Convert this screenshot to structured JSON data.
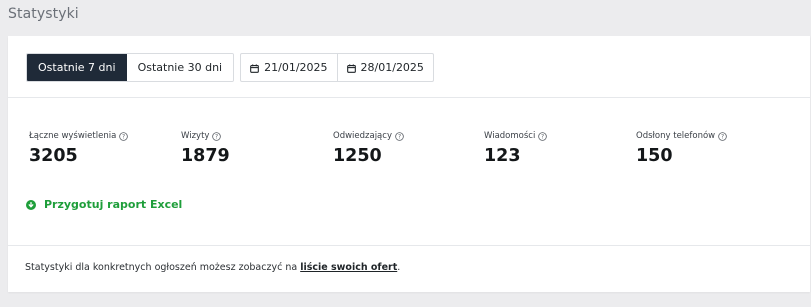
{
  "header": {
    "title": "Statystyki"
  },
  "range_tabs": [
    {
      "label": "Ostatnie 7 dni",
      "active": true
    },
    {
      "label": "Ostatnie 30 dni",
      "active": false
    }
  ],
  "date_range": {
    "from": "21/01/2025",
    "to": "28/01/2025"
  },
  "stats": [
    {
      "label": "Łączne wyświetlenia",
      "value": "3205"
    },
    {
      "label": "Wizyty",
      "value": "1879"
    },
    {
      "label": "Odwiedzający",
      "value": "1250"
    },
    {
      "label": "Wiadomości",
      "value": "123"
    },
    {
      "label": "Odsłony telefonów",
      "value": "150"
    }
  ],
  "excel_link": {
    "label": "Przygotuj raport Excel"
  },
  "footer": {
    "text_before": "Statystyki dla konkretnych ogłoszeń możesz zobaczyć na ",
    "link_text": "liście swoich ofert",
    "text_after": "."
  },
  "colors": {
    "active_tab_bg": "#1f2a38",
    "accent_green": "#1e9e3a",
    "page_bg": "#ececee"
  }
}
